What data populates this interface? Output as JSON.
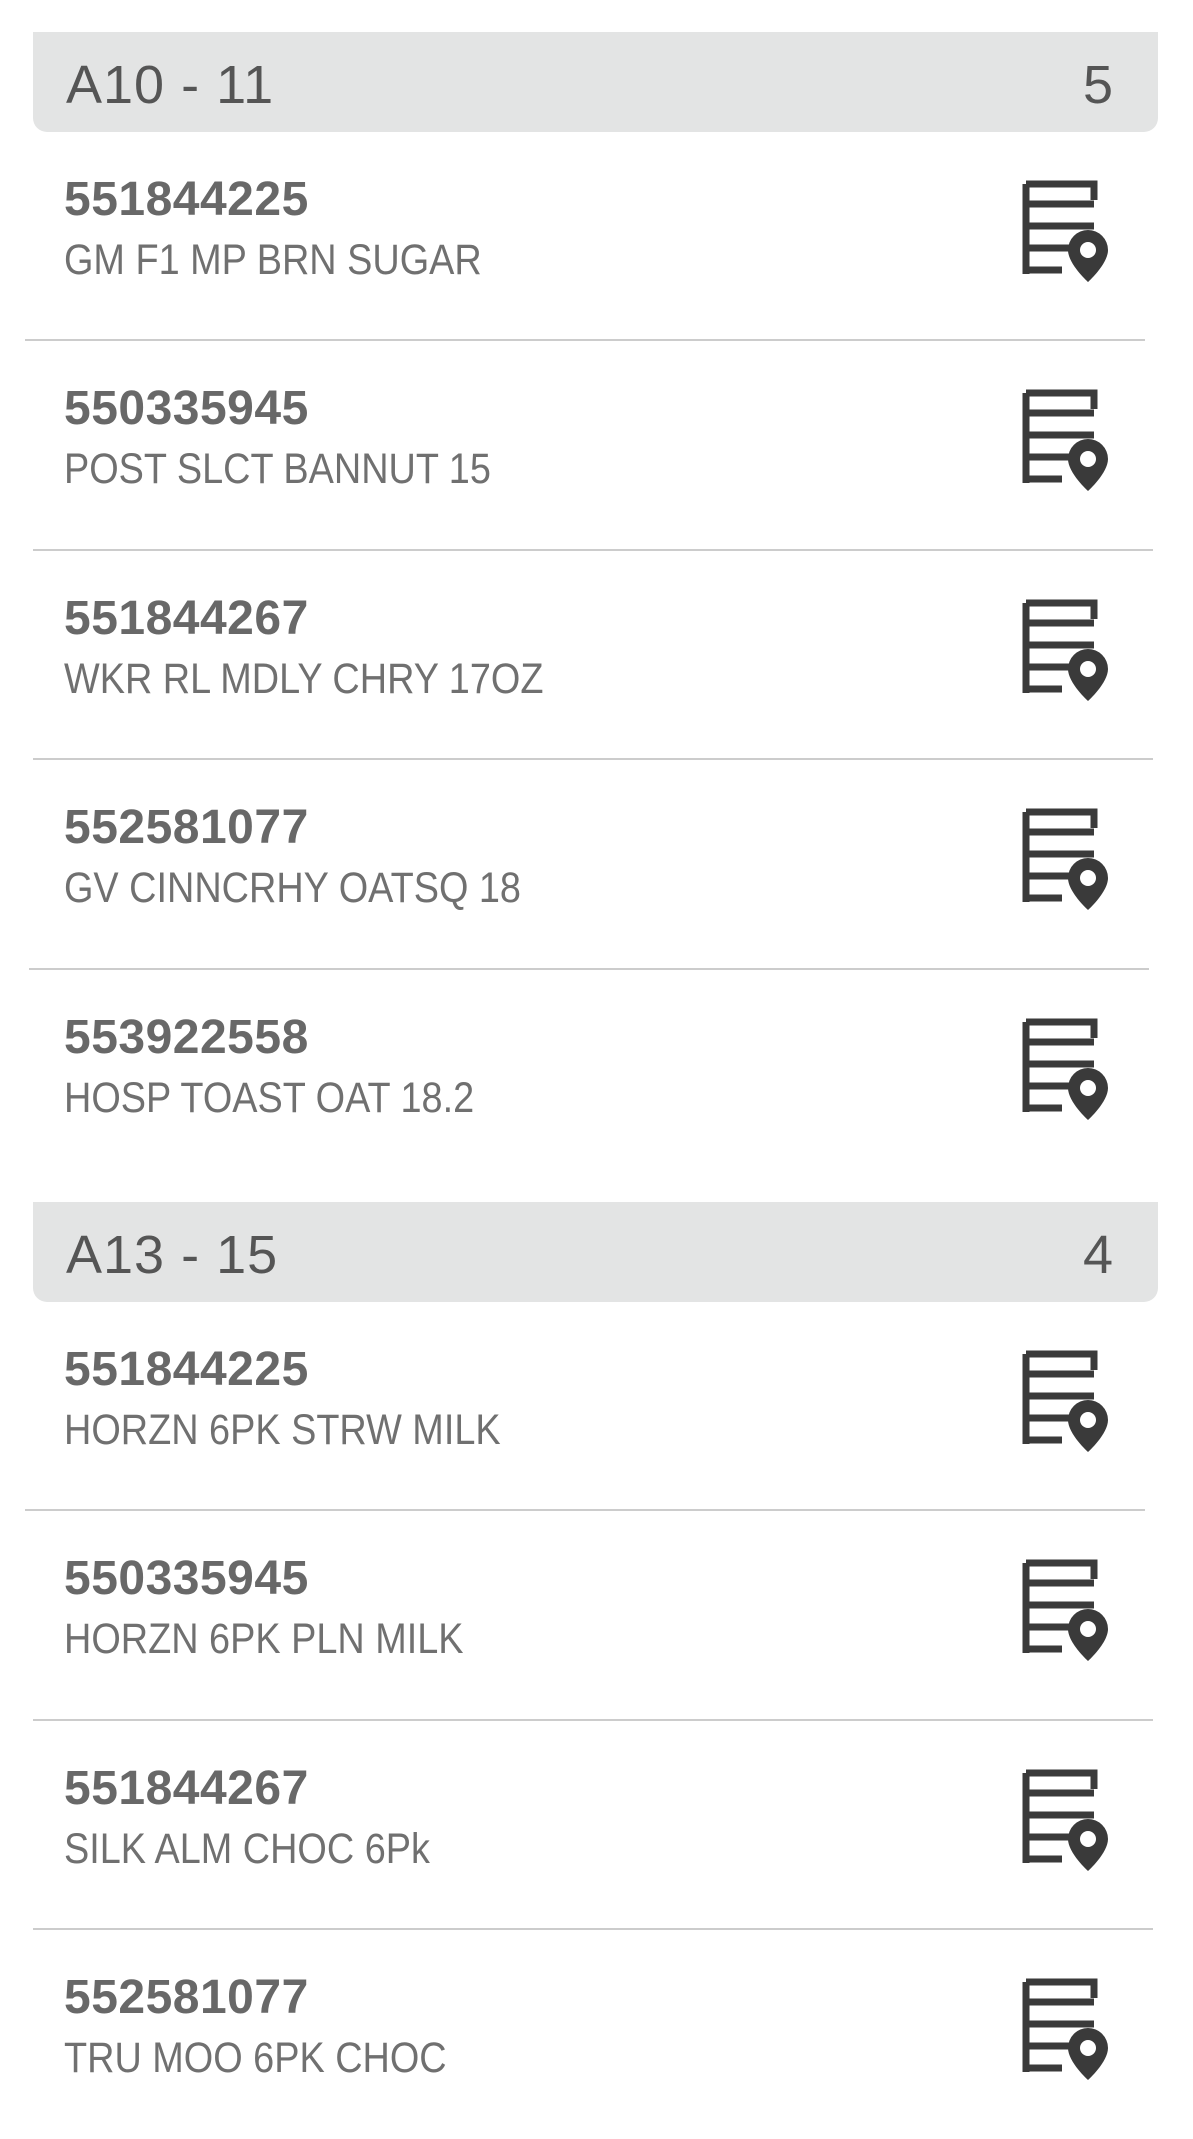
{
  "sections": [
    {
      "title": "A10 - 11",
      "count": "5",
      "items": [
        {
          "id": "551844225",
          "name": "GM F1 MP BRN SUGAR",
          "icon": "shelf-location-icon"
        },
        {
          "id": "550335945",
          "name": "POST SLCT BANNUT 15",
          "icon": "shelf-location-icon"
        },
        {
          "id": "551844267",
          "name": "WKR RL MDLY CHRY 17OZ",
          "icon": "shelf-location-icon"
        },
        {
          "id": "552581077",
          "name": "GV CINNCRHY OATSQ 18",
          "icon": "shelf-location-icon"
        },
        {
          "id": "553922558",
          "name": "HOSP TOAST OAT 18.2",
          "icon": "shelf-location-icon"
        }
      ]
    },
    {
      "title": "A13 - 15",
      "count": "4",
      "items": [
        {
          "id": "551844225",
          "name": "HORZN 6PK STRW MILK",
          "icon": "shelf-location-icon"
        },
        {
          "id": "550335945",
          "name": "HORZN 6PK PLN MILK",
          "icon": "shelf-location-icon"
        },
        {
          "id": "551844267",
          "name": "SILK ALM CHOC 6Pk",
          "icon": "shelf-location-icon"
        },
        {
          "id": "552581077",
          "name": "TRU MOO 6PK CHOC",
          "icon": "shelf-location-icon"
        }
      ]
    }
  ],
  "colors": {
    "header_bg": "#e3e4e4",
    "text": "#666666",
    "icon": "#3a3a3a",
    "divider": "#cccccc"
  }
}
